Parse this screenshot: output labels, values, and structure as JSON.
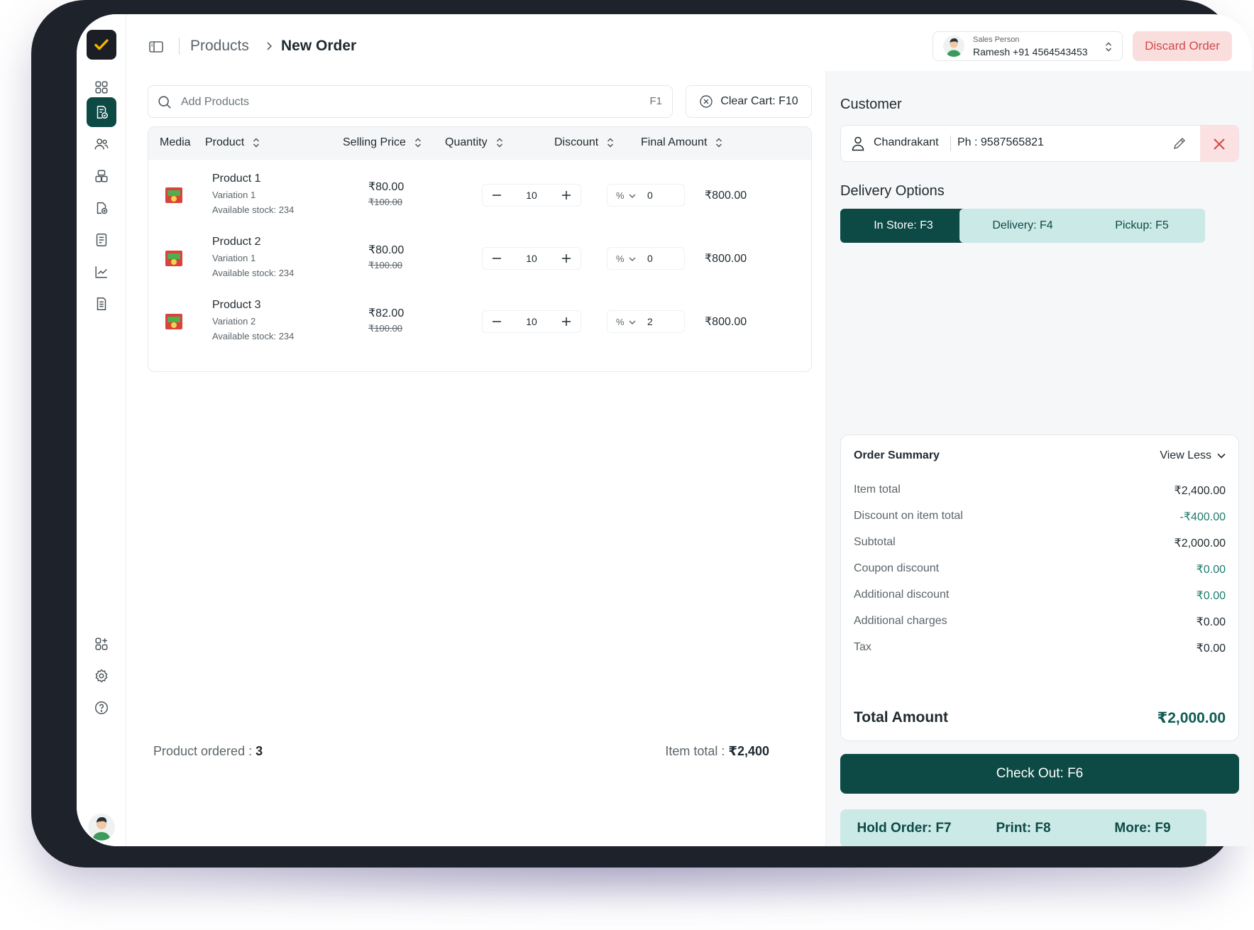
{
  "breadcrumb": {
    "parent": "Products",
    "current": "New Order"
  },
  "sales_person": {
    "label": "Sales Person",
    "name": "Ramesh",
    "phone": "+91 4564543453",
    "display": "Ramesh  +91 4564543453"
  },
  "header": {
    "discard_label": "Discard Order"
  },
  "search": {
    "placeholder": "Add Products",
    "value": "",
    "shortcut": "F1"
  },
  "clear_cart_label": "Clear Cart: F10",
  "table": {
    "headers": {
      "media": "Media",
      "product": "Product",
      "price": "Selling Price",
      "quantity": "Quantity",
      "discount": "Discount",
      "final": "Final Amount"
    },
    "rows": [
      {
        "name": "Product 1",
        "variation": "Variation 1",
        "stock": "Available stock: 234",
        "price": "₹80.00",
        "mrp": "₹100.00",
        "quantity": "10",
        "discount_type": "%",
        "discount": "0",
        "final": "₹800.00"
      },
      {
        "name": "Product 2",
        "variation": "Variation 1",
        "stock": "Available stock: 234",
        "price": "₹80.00",
        "mrp": "₹100.00",
        "quantity": "10",
        "discount_type": "%",
        "discount": "0",
        "final": "₹800.00"
      },
      {
        "name": "Product 3",
        "variation": "Variation 2",
        "stock": "Available stock: 234",
        "price": "₹82.00",
        "mrp": "₹100.00",
        "quantity": "10",
        "discount_type": "%",
        "discount": "2",
        "final": "₹800.00"
      }
    ]
  },
  "footer": {
    "ordered_label": "Product ordered : ",
    "ordered_count": "3",
    "item_total_label": "Item total : ",
    "item_total_value": "₹2,400"
  },
  "customer": {
    "title": "Customer",
    "name": "Chandrakant",
    "phone": "Ph : 9587565821"
  },
  "delivery": {
    "title": "Delivery Options",
    "options": [
      "In Store: F3",
      "Delivery: F4",
      "Pickup: F5"
    ],
    "selected": "In Store: F3"
  },
  "summary": {
    "title": "Order Summary",
    "toggle": "View Less",
    "rows": [
      {
        "label": "Item total",
        "value": "₹2,400.00"
      },
      {
        "label": "Discount on item total",
        "value": "-₹400.00"
      },
      {
        "label": "Subtotal",
        "value": "₹2,000.00"
      },
      {
        "label": "Coupon discount",
        "value": "₹0.00"
      },
      {
        "label": "Additional discount",
        "value": "₹0.00"
      },
      {
        "label": "Additional charges",
        "value": "₹0.00"
      },
      {
        "label": "Tax",
        "value": "₹0.00"
      }
    ],
    "total_label": "Total Amount",
    "total_value": "₹2,000.00"
  },
  "actions": {
    "checkout": "Check Out: F6",
    "hold": "Hold Order: F7",
    "print": "Print: F8",
    "more": "More: F9"
  },
  "colors": {
    "primary": "#0d4a45",
    "primary_light": "#cbe9e7",
    "danger_bg": "#fadede",
    "danger": "#d24848",
    "accent_green": "#1e7a6e",
    "logo_check": "#f5b400"
  },
  "icons": {
    "sidebar": [
      "logo-check-icon",
      "dashboard-icon",
      "orders-icon",
      "customers-icon",
      "inventory-icon",
      "products-icon",
      "invoice-icon",
      "analytics-icon",
      "reports-icon",
      "add-app-icon",
      "settings-icon",
      "help-icon"
    ]
  }
}
